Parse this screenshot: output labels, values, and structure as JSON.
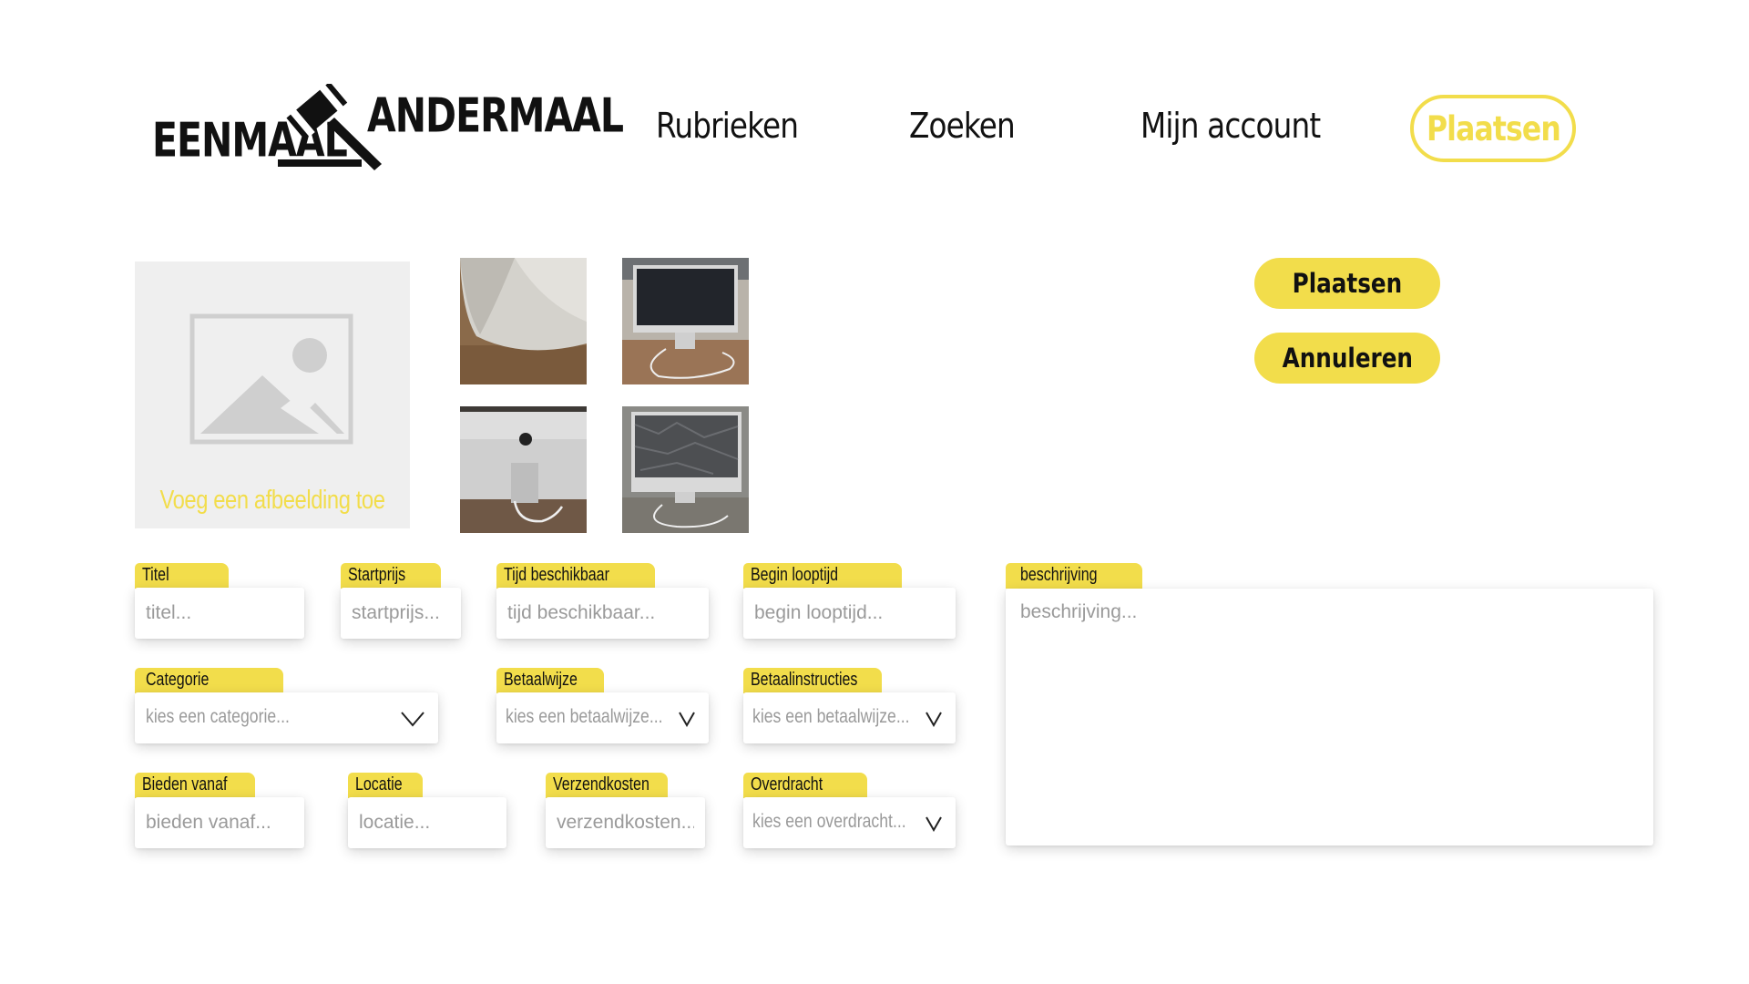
{
  "brand": {
    "word_left": "EENMAAL",
    "word_right": "ANDERMAAL",
    "accent": "#f2dd4b",
    "icon": "gavel-icon"
  },
  "nav": {
    "rubrieken": "Rubrieken",
    "zoeken": "Zoeken",
    "mijn_account": "Mijn account",
    "plaatsen": "Plaatsen"
  },
  "upload": {
    "label": "Voeg een afbeelding toe",
    "icon": "image-placeholder-icon"
  },
  "thumbnails": [
    {
      "name": "imac-stand-closeup"
    },
    {
      "name": "imac-front"
    },
    {
      "name": "imac-back"
    },
    {
      "name": "imac-covered-screen"
    }
  ],
  "actions": {
    "plaatsen": "Plaatsen",
    "annuleren": "Annuleren"
  },
  "form": {
    "titel": {
      "label": "Titel",
      "placeholder": "titel..."
    },
    "startprijs": {
      "label": "Startprijs",
      "placeholder": "startprijs..."
    },
    "tijd_beschikbaar": {
      "label": "Tijd beschikbaar",
      "placeholder": "tijd beschikbaar..."
    },
    "begin_looptijd": {
      "label": "Begin looptijd",
      "placeholder": "begin looptijd..."
    },
    "beschrijving": {
      "label": "beschrijving",
      "placeholder": "beschrijving..."
    },
    "categorie": {
      "label": "Categorie",
      "placeholder": "kies een categorie..."
    },
    "betaalwijze": {
      "label": "Betaalwijze",
      "placeholder": "kies een betaalwijze..."
    },
    "betaalinstructies": {
      "label": "Betaalinstructies",
      "placeholder": "kies een betaalwijze..."
    },
    "bieden_vanaf": {
      "label": "Bieden vanaf",
      "placeholder": "bieden vanaf..."
    },
    "locatie": {
      "label": "Locatie",
      "placeholder": "locatie..."
    },
    "verzendkosten": {
      "label": "Verzendkosten",
      "placeholder": "verzendkosten..."
    },
    "overdracht": {
      "label": "Overdracht",
      "placeholder": "kies een overdracht..."
    }
  }
}
